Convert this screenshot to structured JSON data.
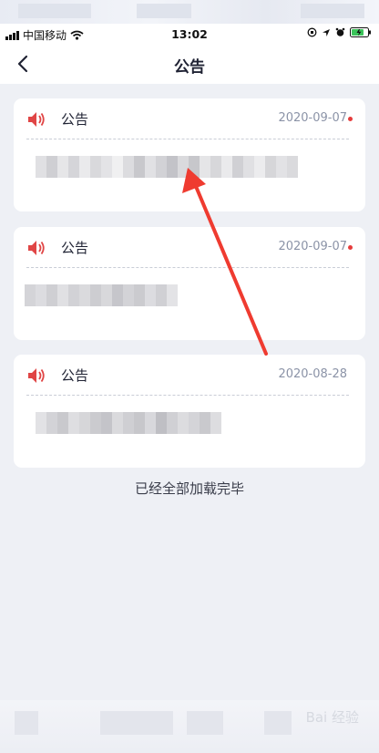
{
  "status_bar": {
    "carrier": "中国移动",
    "time": "13:02"
  },
  "nav": {
    "title": "公告",
    "back_icon": "chevron-left-icon"
  },
  "notices": [
    {
      "title": "公告",
      "date": "2020-09-07",
      "unread": true,
      "icon": "speaker-icon"
    },
    {
      "title": "公告",
      "date": "2020-09-07",
      "unread": true,
      "icon": "speaker-icon"
    },
    {
      "title": "公告",
      "date": "2020-08-28",
      "unread": false,
      "icon": "speaker-icon"
    }
  ],
  "footer": {
    "message": "已经全部加载完毕"
  },
  "watermark": "Bai 经验",
  "colors": {
    "background": "#eef0f5",
    "card": "#ffffff",
    "unread_dot": "#e63c3c",
    "speaker": "#e04545",
    "annotation_arrow": "#ef3b30"
  }
}
